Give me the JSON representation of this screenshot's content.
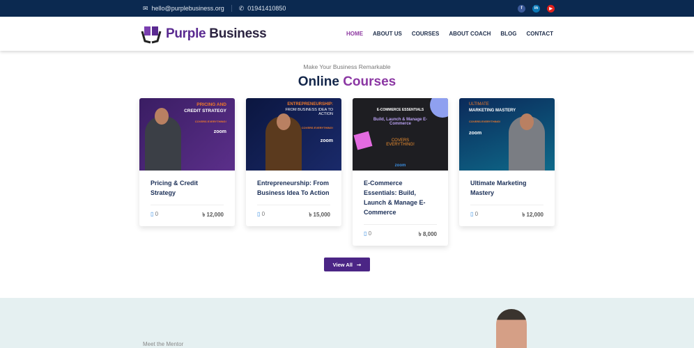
{
  "topbar": {
    "email": "hello@purplebusiness.org",
    "phone": "01941410850",
    "social": [
      "facebook-icon",
      "linkedin-icon",
      "youtube-icon"
    ]
  },
  "header": {
    "logo_part1": "Purple",
    "logo_part2": " Business",
    "logo_mark": "PB",
    "nav": [
      "HOME",
      "ABOUT US",
      "COURSES",
      "ABOUT COACH",
      "BLOG",
      "CONTACT"
    ]
  },
  "section": {
    "subtitle": "Make Your Business Remarkable",
    "title_part1": "Online",
    "title_part2": "Courses"
  },
  "courses": [
    {
      "title": "Pricing & Credit Strategy",
      "students": "0",
      "price": "৳ 12,000",
      "banner": [
        "PRICING AND",
        "CREDIT STRATEGY",
        "COVERS EVERYTHING!",
        "zoom"
      ]
    },
    {
      "title": "Entrepreneurship: From Business Idea To Action",
      "students": "0",
      "price": "৳ 15,000",
      "banner": [
        "ENTREPRENEURSHIP:",
        "FROM BUSINESS IDEA TO ACTION",
        "COVERS EVERYTHING!",
        "zoom"
      ]
    },
    {
      "title": "E-Commerce Essentials: Build, Launch & Manage E-Commerce",
      "students": "0",
      "price": "৳ 8,000",
      "banner": [
        "E-COMMERCE ESSENTIALS",
        "Build, Launch & Manage E-Commerce",
        "COVERS EVERYTHING!",
        "zoom"
      ]
    },
    {
      "title": "Ultimate Marketing Mastery",
      "students": "0",
      "price": "৳ 12,000",
      "banner": [
        "ULTIMATE",
        "MARKETING MASTERY",
        "COVERS EVERYTHING!",
        "zoom"
      ]
    }
  ],
  "view_all": "View All",
  "mentor": {
    "label": "Meet the Mentor"
  },
  "colors": {
    "primary": "#4b2585",
    "accent": "#8b37a3",
    "navy": "#0b2950"
  }
}
